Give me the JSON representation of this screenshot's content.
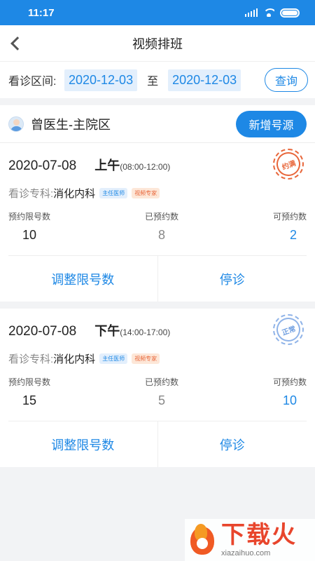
{
  "status_bar": {
    "time": "11:17"
  },
  "nav": {
    "title": "视频排班"
  },
  "filter": {
    "label": "看诊区间:",
    "start_date": "2020-12-03",
    "separator": "至",
    "end_date": "2020-12-03",
    "query_label": "查询"
  },
  "doctor": {
    "name": "曾医生-主院区",
    "add_label": "新增号源"
  },
  "schedules": [
    {
      "date": "2020-07-08",
      "period": "上午",
      "range": "(08:00-12:00)",
      "stamp": "约满",
      "dept_label": "看诊专科:",
      "dept": "消化内科",
      "tags": [
        "主任医师",
        "视频专家"
      ],
      "stats": [
        {
          "label": "预约限号数",
          "value": "10"
        },
        {
          "label": "已预约数",
          "value": "8"
        },
        {
          "label": "可预约数",
          "value": "2"
        }
      ],
      "actions": [
        "调整限号数",
        "停诊"
      ]
    },
    {
      "date": "2020-07-08",
      "period": "下午",
      "range": "(14:00-17:00)",
      "stamp": "正常",
      "dept_label": "看诊专科:",
      "dept": "消化内科",
      "tags": [
        "主任医师",
        "视频专家"
      ],
      "stats": [
        {
          "label": "预约限号数",
          "value": "15"
        },
        {
          "label": "已预约数",
          "value": "5"
        },
        {
          "label": "可预约数",
          "value": "10"
        }
      ],
      "actions": [
        "调整限号数",
        "停诊"
      ]
    }
  ],
  "watermark": {
    "brand": "下载火",
    "url": "xiazaihuo.com"
  },
  "colors": {
    "primary": "#1e88e5",
    "stamp_full": "#e8663a",
    "stamp_normal": "#8fb3e8"
  }
}
